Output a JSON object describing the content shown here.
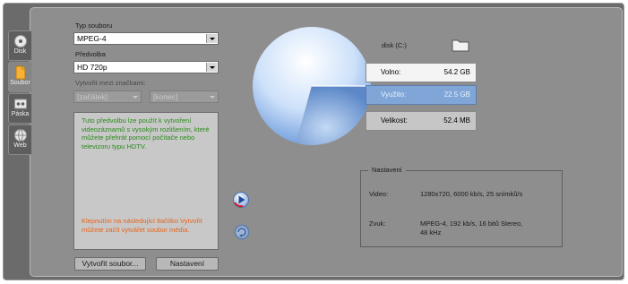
{
  "tabs": [
    {
      "label": "Disk",
      "icon": "disc-icon",
      "active": false
    },
    {
      "label": "Soubor",
      "icon": "file-icon",
      "active": true
    },
    {
      "label": "Páska",
      "icon": "tape-icon",
      "active": false
    },
    {
      "label": "Web",
      "icon": "globe-icon",
      "active": false
    }
  ],
  "form": {
    "file_type_label": "Typ souboru",
    "file_type_value": "MPEG-4",
    "preset_label": "Předvolba",
    "preset_value": "HD 720p",
    "between_marks_label": "Vytvořit mezi značkami:",
    "start_value": "[začátek]",
    "end_value": "[konec]"
  },
  "description": {
    "text": "Tuto předvolbu lze použít k vytvoření videozáznamů s vysokým rozlišením, které můžete přehrát pomocí počítače nebo televizoru typu HDTV.",
    "hint": "Klepnutím na následující tlačítko Vytvořit můžete začít vytvářet soubor média."
  },
  "buttons": {
    "create": "Vytvořit soubor...",
    "settings": "Nastavení"
  },
  "disk": {
    "label": "disk (C:)",
    "rows": [
      {
        "key": "Volno:",
        "value": "54.2 GB"
      },
      {
        "key": "Využito:",
        "value": "22.5 GB"
      },
      {
        "key": "Velikost:",
        "value": "52.4 MB"
      }
    ],
    "used_fraction": 0.293
  },
  "settings": {
    "title": "Nastavení",
    "video_label": "Video:",
    "video_value": "1280x720, 6000 kb/s, 25 snímků/s",
    "audio_label": "Zvuk:",
    "audio_value_line1": "MPEG-4, 192 kb/s, 16 bitů Stereo,",
    "audio_value_line2": "48 kHz"
  },
  "colors": {
    "free_row": "#f4f4f4",
    "used_row": "#7fa6d6",
    "size_row": "#c6c6c6",
    "description_text": "#2a8a1a",
    "hint_text": "#e8641a"
  }
}
